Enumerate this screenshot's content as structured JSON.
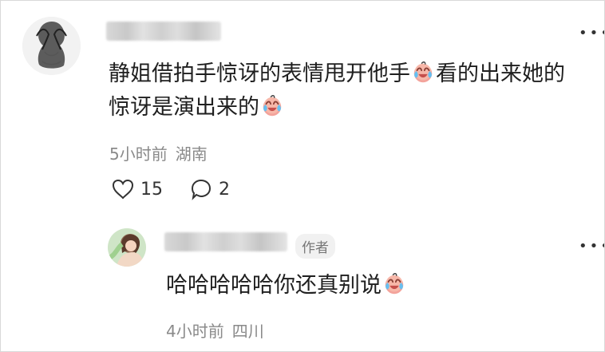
{
  "comment": {
    "text_line1": "静姐借拍手惊讶的表情甩开他手",
    "text_line1_after_emoji": "看的出来她的",
    "text_line2": "惊讶是演出来的",
    "time": "5小时前",
    "location": "湖南",
    "like_count": "15",
    "reply_count": "2"
  },
  "reply": {
    "author_badge": "作者",
    "text": "哈哈哈哈哈你还真别说",
    "time": "4小时前",
    "location": "四川"
  },
  "icons": {
    "more": "more-icon",
    "like": "heart-icon",
    "reply": "comment-bubble-icon",
    "emoji": "laugh-cry-emoji"
  }
}
